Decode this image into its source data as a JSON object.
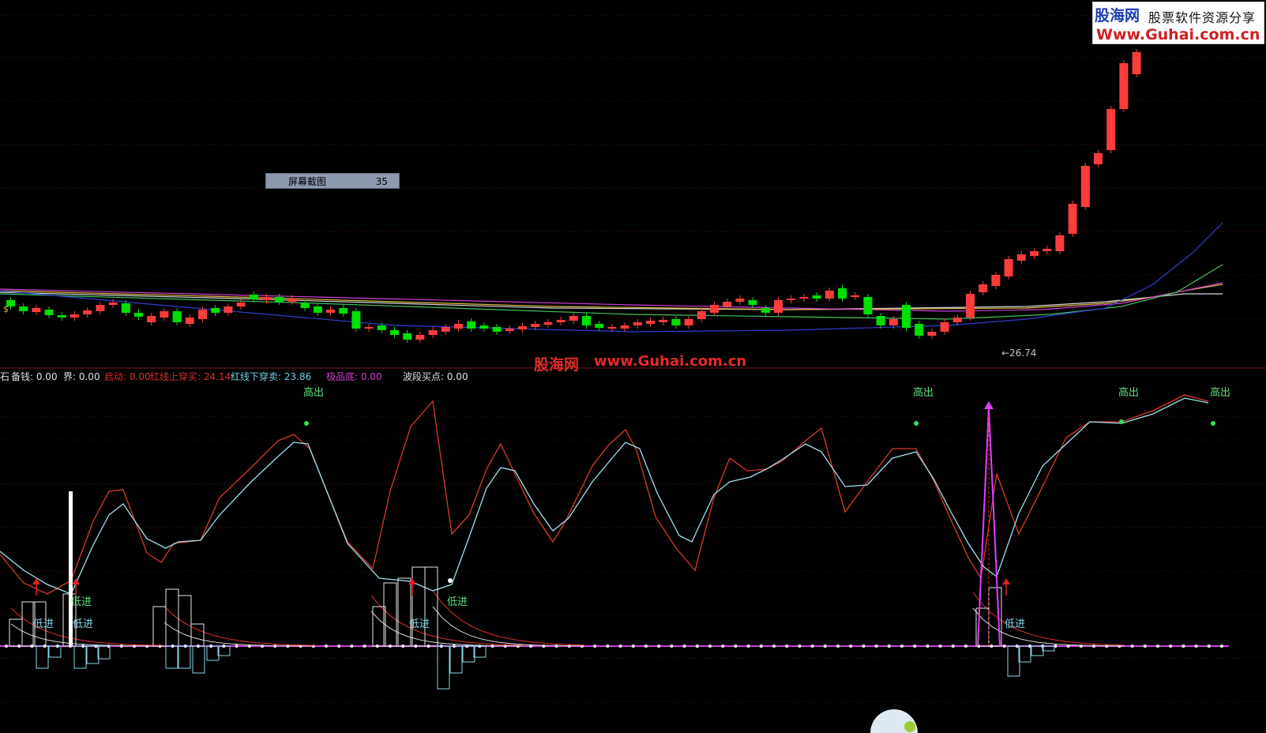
{
  "watermark": {
    "logo_cn": "股海网",
    "logo_slogan": "股票软件资源分享",
    "logo_url": "Www.Guhai.com.cn",
    "center_cn": "股海网",
    "center_url": "www.Guhai.com.cn"
  },
  "tooltip": {
    "title": "屏幕截图",
    "value": "35"
  },
  "price_label": "←26.74",
  "candle_marker": "$",
  "indicator_bar": {
    "prefix": "石",
    "items": [
      {
        "label": "备钱: 0.00",
        "color": "#e0e0e0"
      },
      {
        "label": "界: 0.00",
        "color": "#e0e0e0"
      },
      {
        "label": "启动: 0.00",
        "color": "#d83030"
      },
      {
        "label": "红线上穿买: 24.14",
        "color": "#d83030"
      },
      {
        "label": "红线下穿卖: 23.86",
        "color": "#6fd0e8"
      },
      {
        "label": "极品底: 0.00",
        "color": "#d040d0"
      },
      {
        "label": "波段买点: 0.00",
        "color": "#e0e0e0"
      }
    ]
  },
  "signals": {
    "high_out": "高出",
    "low_in": "低进"
  },
  "colors": {
    "up": "#ff3c3c",
    "down": "#00e000",
    "grid": "#5a1010",
    "divider": "#7a1818",
    "fast_line": "#d83a2a",
    "slow_line": "#a0e0f0",
    "baseline": "#d040e0",
    "magenta_spike": "#e040ff"
  },
  "chart_data": {
    "type": "candlestick",
    "candles": [
      {
        "c": "down",
        "o": 380,
        "cl": 388
      },
      {
        "c": "down",
        "o": 388,
        "cl": 394
      },
      {
        "c": "up",
        "o": 395,
        "cl": 390
      },
      {
        "c": "down",
        "o": 392,
        "cl": 399
      },
      {
        "c": "down",
        "o": 399,
        "cl": 402
      },
      {
        "c": "up",
        "o": 402,
        "cl": 398
      },
      {
        "c": "up",
        "o": 398,
        "cl": 393
      },
      {
        "c": "up",
        "o": 394,
        "cl": 386
      },
      {
        "c": "up",
        "o": 386,
        "cl": 383
      },
      {
        "c": "down",
        "o": 384,
        "cl": 396
      },
      {
        "c": "down",
        "o": 396,
        "cl": 401
      },
      {
        "c": "up",
        "o": 408,
        "cl": 400
      },
      {
        "c": "up",
        "o": 402,
        "cl": 394
      },
      {
        "c": "down",
        "o": 394,
        "cl": 408
      },
      {
        "c": "up",
        "o": 410,
        "cl": 402
      },
      {
        "c": "up",
        "o": 404,
        "cl": 392
      },
      {
        "c": "down",
        "o": 390,
        "cl": 396
      },
      {
        "c": "up",
        "o": 396,
        "cl": 388
      },
      {
        "c": "up",
        "o": 388,
        "cl": 383
      },
      {
        "c": "down",
        "o": 373,
        "cl": 379
      },
      {
        "c": "up",
        "o": 380,
        "cl": 376
      },
      {
        "c": "down",
        "o": 376,
        "cl": 382
      },
      {
        "c": "up",
        "o": 382,
        "cl": 378
      },
      {
        "c": "down",
        "o": 384,
        "cl": 390
      },
      {
        "c": "down",
        "o": 388,
        "cl": 396
      },
      {
        "c": "up",
        "o": 396,
        "cl": 392
      },
      {
        "c": "down",
        "o": 390,
        "cl": 397
      },
      {
        "c": "down",
        "o": 394,
        "cl": 416
      },
      {
        "c": "up",
        "o": 416,
        "cl": 414
      },
      {
        "c": "down",
        "o": 412,
        "cl": 418
      },
      {
        "c": "down",
        "o": 418,
        "cl": 424
      },
      {
        "c": "down",
        "o": 422,
        "cl": 430
      },
      {
        "c": "up",
        "o": 430,
        "cl": 424
      },
      {
        "c": "up",
        "o": 424,
        "cl": 418
      },
      {
        "c": "up",
        "o": 420,
        "cl": 414
      },
      {
        "c": "up",
        "o": 416,
        "cl": 410
      },
      {
        "c": "down",
        "o": 407,
        "cl": 416
      },
      {
        "c": "down",
        "o": 412,
        "cl": 416
      },
      {
        "c": "down",
        "o": 414,
        "cl": 420
      },
      {
        "c": "up",
        "o": 419,
        "cl": 416
      },
      {
        "c": "up",
        "o": 417,
        "cl": 413
      },
      {
        "c": "up",
        "o": 414,
        "cl": 410
      },
      {
        "c": "up",
        "o": 411,
        "cl": 408
      },
      {
        "c": "up",
        "o": 408,
        "cl": 405
      },
      {
        "c": "up",
        "o": 406,
        "cl": 400
      },
      {
        "c": "down",
        "o": 400,
        "cl": 412
      },
      {
        "c": "down",
        "o": 410,
        "cl": 415
      },
      {
        "c": "up",
        "o": 416,
        "cl": 414
      },
      {
        "c": "up",
        "o": 416,
        "cl": 412
      },
      {
        "c": "up",
        "o": 412,
        "cl": 408
      },
      {
        "c": "up",
        "o": 410,
        "cl": 406
      },
      {
        "c": "up",
        "o": 408,
        "cl": 405
      },
      {
        "c": "down",
        "o": 404,
        "cl": 412
      },
      {
        "c": "up",
        "o": 412,
        "cl": 404
      },
      {
        "c": "up",
        "o": 404,
        "cl": 394
      },
      {
        "c": "up",
        "o": 396,
        "cl": 386
      },
      {
        "c": "up",
        "o": 388,
        "cl": 382
      },
      {
        "c": "up",
        "o": 382,
        "cl": 378
      },
      {
        "c": "down",
        "o": 380,
        "cl": 386
      },
      {
        "c": "down",
        "o": 390,
        "cl": 396
      },
      {
        "c": "up",
        "o": 396,
        "cl": 380
      },
      {
        "c": "up",
        "o": 380,
        "cl": 378
      },
      {
        "c": "up",
        "o": 378,
        "cl": 376
      },
      {
        "c": "down",
        "o": 374,
        "cl": 378
      },
      {
        "c": "up",
        "o": 378,
        "cl": 368
      },
      {
        "c": "down",
        "o": 365,
        "cl": 378
      },
      {
        "c": "up",
        "o": 376,
        "cl": 374
      },
      {
        "c": "down",
        "o": 376,
        "cl": 398
      },
      {
        "c": "down",
        "o": 400,
        "cl": 412
      },
      {
        "c": "up",
        "o": 412,
        "cl": 404
      },
      {
        "c": "down",
        "o": 386,
        "cl": 415
      },
      {
        "c": "down",
        "o": 410,
        "cl": 425
      },
      {
        "c": "up",
        "o": 425,
        "cl": 420
      },
      {
        "c": "up",
        "o": 420,
        "cl": 408
      },
      {
        "c": "up",
        "o": 408,
        "cl": 402
      },
      {
        "c": "up",
        "o": 402,
        "cl": 372
      },
      {
        "c": "up",
        "o": 370,
        "cl": 360
      },
      {
        "c": "up",
        "o": 362,
        "cl": 348
      },
      {
        "c": "up",
        "o": 350,
        "cl": 328
      },
      {
        "c": "up",
        "o": 330,
        "cl": 322
      },
      {
        "c": "up",
        "o": 324,
        "cl": 318
      },
      {
        "c": "up",
        "o": 318,
        "cl": 315
      },
      {
        "c": "up",
        "o": 318,
        "cl": 298
      },
      {
        "c": "up",
        "o": 296,
        "cl": 258
      },
      {
        "c": "up",
        "o": 262,
        "cl": 210
      },
      {
        "c": "up",
        "o": 208,
        "cl": 194
      },
      {
        "c": "up",
        "o": 190,
        "cl": 138
      },
      {
        "c": "up",
        "o": 138,
        "cl": 80
      },
      {
        "c": "up",
        "o": 94,
        "cl": 66
      }
    ],
    "price_low_label": 26.74
  }
}
